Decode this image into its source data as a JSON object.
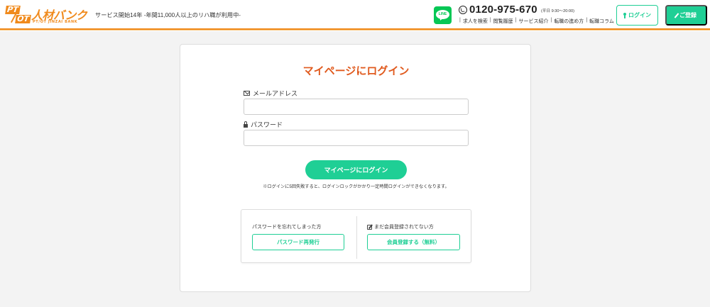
{
  "header": {
    "logo": {
      "pt": "PT",
      "ot": "OT",
      "main": "人材バンク",
      "sub": "PT/OT JINZAI BANK"
    },
    "tagline": "サービス開始14年 -年間11,000人以上のリハ職が利用中-",
    "line_label": "LINE",
    "phone_number": "0120-975-670",
    "phone_hours": "(平日 9:30〜20:00)",
    "subnav": [
      "求人を検索",
      "閲覧履歴",
      "サービス紹介",
      "転職の進め方",
      "転職コラム"
    ],
    "login_label": "ログイン",
    "register_label": "ご登録",
    "colors": {
      "accent": "#1fcf95",
      "brand_orange": "#f08a1c",
      "line_green": "#06c755"
    }
  },
  "login_card": {
    "title": "マイページにログイン",
    "title_color": "#e05a1e",
    "email_label": "メールアドレス",
    "email_value": "",
    "email_placeholder": "",
    "password_label": "パスワード",
    "password_value": "",
    "password_placeholder": "",
    "submit_label": "マイページにログイン",
    "notice": "※ログインに5回失敗すると、ログインロックがかかり一定時間ログインができなくなります。",
    "forgot": {
      "label": "パスワードを忘れてしまった方",
      "button": "パスワード再発行"
    },
    "signup": {
      "label": "まだ会員登録されてない方",
      "button": "会員登録する（無料）"
    }
  }
}
